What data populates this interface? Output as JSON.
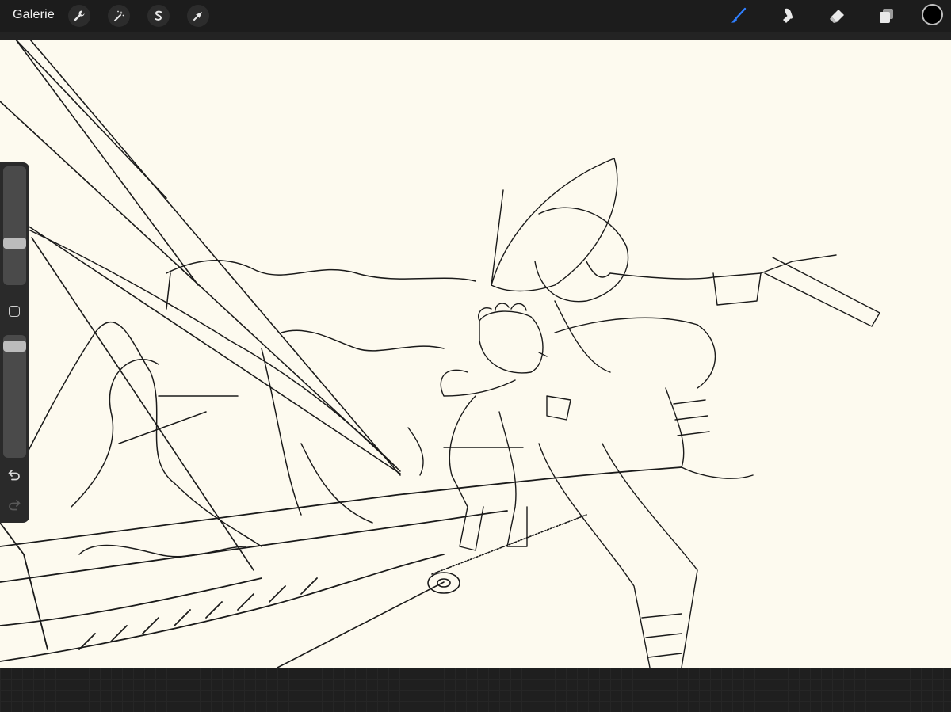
{
  "toolbar": {
    "gallery_label": "Galerie",
    "left_tools": [
      {
        "icon": "wrench-icon",
        "name": "actions"
      },
      {
        "icon": "magic-wand-icon",
        "name": "adjustments"
      },
      {
        "icon": "selection-s-icon",
        "name": "selection"
      },
      {
        "icon": "arrow-cursor-icon",
        "name": "transform"
      }
    ],
    "right_tools": [
      {
        "icon": "brush-icon",
        "name": "paint",
        "active": true
      },
      {
        "icon": "smudge-icon",
        "name": "smudge"
      },
      {
        "icon": "eraser-icon",
        "name": "erase"
      },
      {
        "icon": "layers-icon",
        "name": "layers"
      }
    ],
    "current_color": "#000000",
    "active_color": "#2f7fff"
  },
  "sidebar": {
    "brush_size_level": 0.37,
    "opacity_level": 0.95,
    "modifier_icon": "square-modifier-icon",
    "undo_icon": "undo-icon",
    "redo_icon": "redo-icon"
  },
  "canvas": {
    "background_color": "#fdfaef",
    "stroke_color": "#1a1a1a",
    "artwork": "line-art-sketch"
  }
}
